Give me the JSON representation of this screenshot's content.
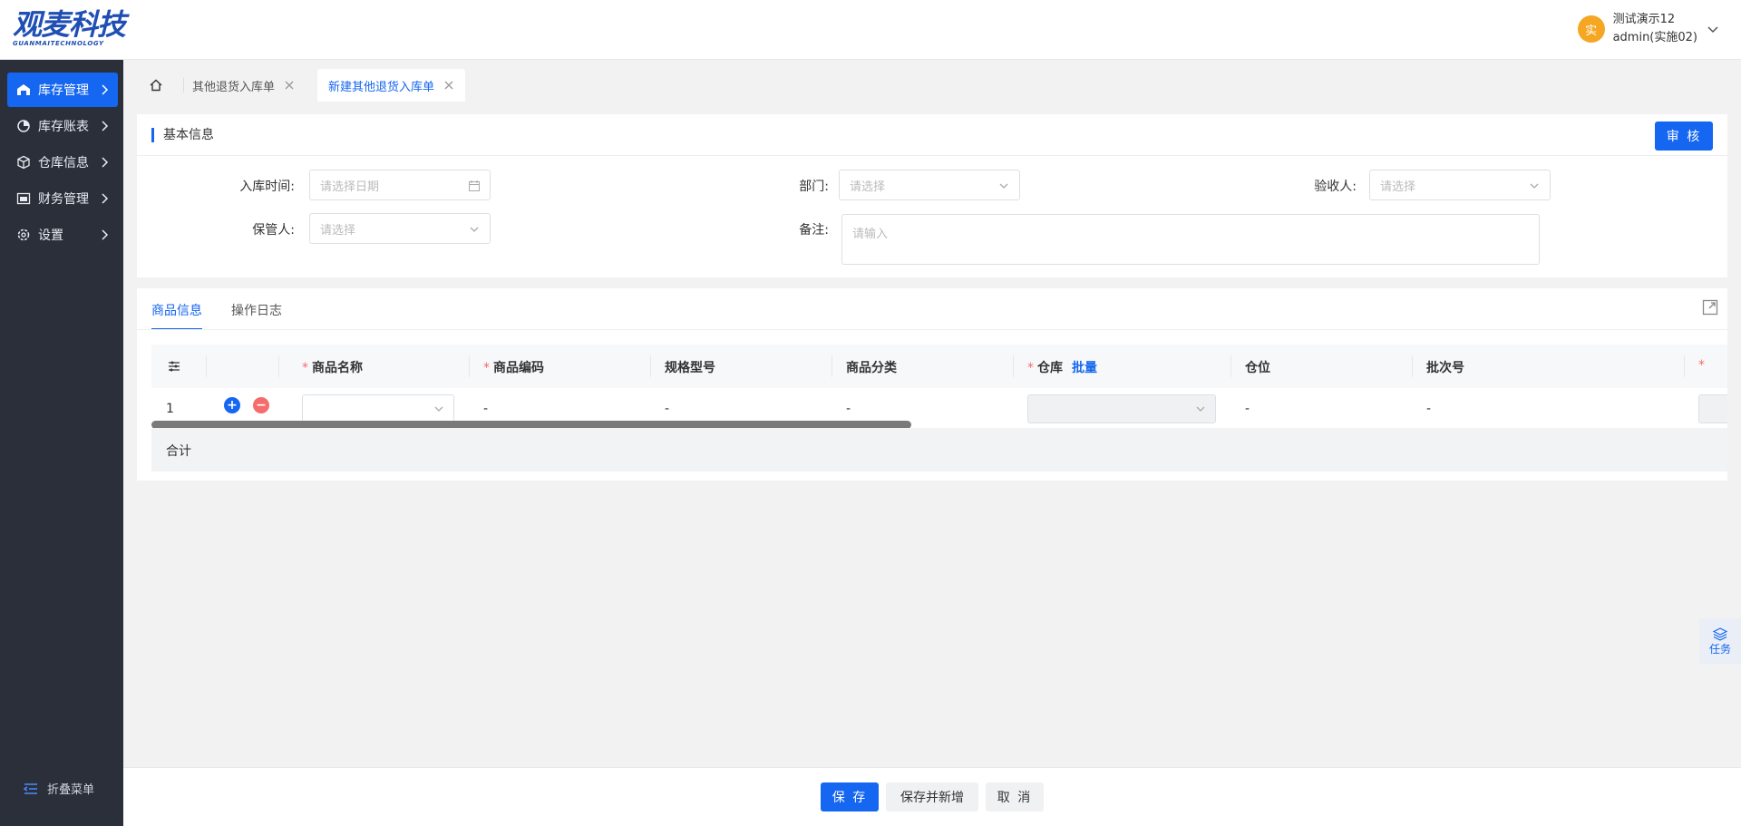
{
  "brand": {
    "logo_cn": "观麦科技",
    "logo_en": "GUANMAITECHNOLOGY"
  },
  "user": {
    "avatar": "实",
    "name": "测试演示12",
    "account": "admin(实施02)"
  },
  "sidebar": {
    "items": [
      {
        "label": "库存管理",
        "icon": "warehouse-icon",
        "active": true
      },
      {
        "label": "库存账表",
        "icon": "pie-chart-icon"
      },
      {
        "label": "仓库信息",
        "icon": "box-icon"
      },
      {
        "label": "财务管理",
        "icon": "finance-icon"
      },
      {
        "label": "设置",
        "icon": "gear-icon"
      }
    ],
    "collapse_label": "折叠菜单"
  },
  "tabs": [
    {
      "label": "其他退货入库单"
    },
    {
      "label": "新建其他退货入库单",
      "active": true
    }
  ],
  "basic": {
    "title": "基本信息",
    "audit": "审 核",
    "fields": {
      "time_label": "入库时间:",
      "time_placeholder": "请选择日期",
      "dept_label": "部门:",
      "dept_placeholder": "请选择",
      "checker_label": "验收人:",
      "checker_placeholder": "请选择",
      "keeper_label": "保管人:",
      "keeper_placeholder": "请选择",
      "remark_label": "备注:",
      "remark_placeholder": "请输入"
    }
  },
  "goods": {
    "tabs": [
      "商品信息",
      "操作日志"
    ],
    "columns": {
      "name": "商品名称",
      "code": "商品编码",
      "spec": "规格型号",
      "category": "商品分类",
      "warehouse": "仓库",
      "batch_link": "批量",
      "position": "仓位",
      "batch_no": "批次号"
    },
    "row": {
      "index": "1",
      "code": "-",
      "spec": "-",
      "category": "-",
      "position": "-",
      "batch_no": "-"
    },
    "total_label": "合计"
  },
  "task_label": "任务",
  "footer": {
    "save": "保 存",
    "save_new": "保存并新增",
    "cancel": "取 消"
  },
  "colors": {
    "primary": "#1566f0",
    "sidebar": "#2b2f3a",
    "danger": "#f56c6c"
  }
}
